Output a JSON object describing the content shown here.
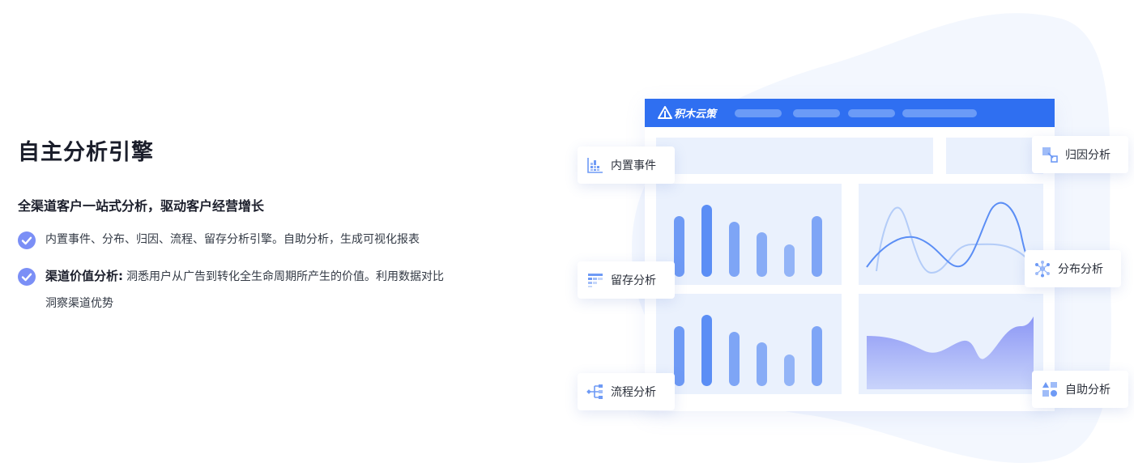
{
  "section": {
    "title": "自主分析引擎",
    "subtitle": "全渠道客户一站式分析，驱动客户经营增长",
    "features": [
      {
        "label": "",
        "text": "内置事件、分布、归因、流程、留存分析引擎。自助分析，生成可视化报表"
      },
      {
        "label": "渠道价值分析:",
        "text": "洞悉用户从广告到转化全生命周期所产生的价值。利用数据对比洞察渠道优势"
      }
    ]
  },
  "illustration": {
    "brand": "积木云策",
    "colors": {
      "titlebar": "#2f6ff1",
      "panel": "#eaf1fd",
      "bar_primary": "#5b8ef5",
      "accent": "#7b8ff6"
    },
    "cards": {
      "builtin_events": {
        "label": "内置事件",
        "icon": "table-grid-icon"
      },
      "retention": {
        "label": "留存分析",
        "icon": "retention-grid-icon"
      },
      "flow": {
        "label": "流程分析",
        "icon": "flow-branch-icon"
      },
      "attribution": {
        "label": "归因分析",
        "icon": "attribution-shapes-icon"
      },
      "distribution": {
        "label": "分布分析",
        "icon": "distribution-network-icon"
      },
      "self_service": {
        "label": "自助分析",
        "icon": "self-service-blocks-icon"
      }
    }
  }
}
